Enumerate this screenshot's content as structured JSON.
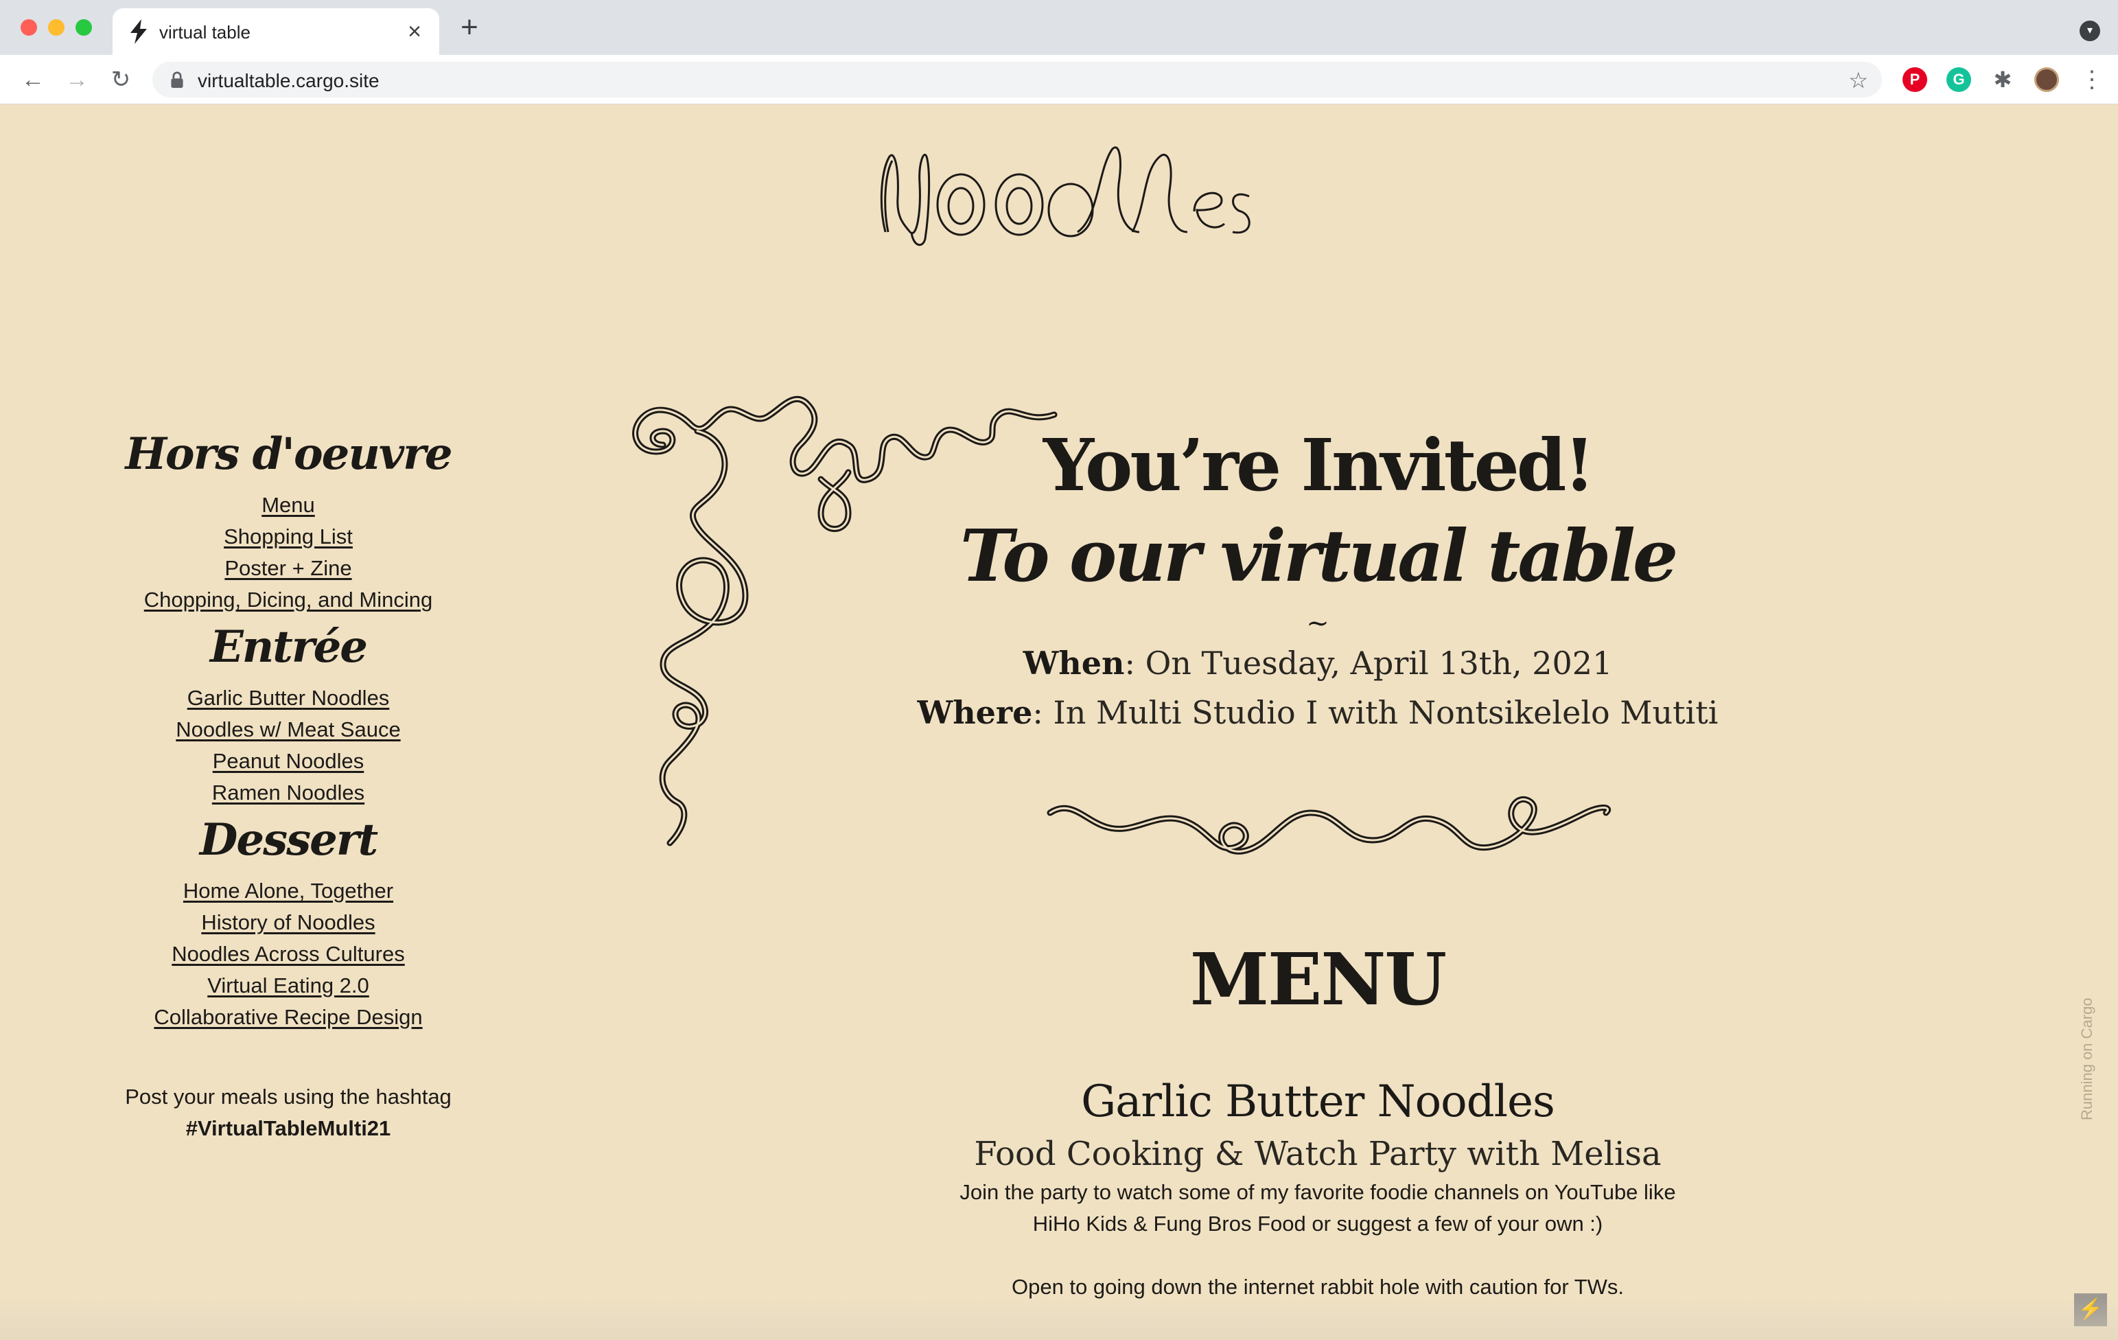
{
  "browser": {
    "tab_title": "virtual table",
    "tab_close": "×",
    "new_tab": "+",
    "url": "virtualtable.cargo.site",
    "nav_back": "←",
    "nav_forward": "→",
    "nav_reload": "↻",
    "bookmark_star": "☆",
    "ext_pinterest": "P",
    "ext_grammarly": "G",
    "ext_puzzle": "✱",
    "menu_kebab": "⋮",
    "tab_menu": "▾"
  },
  "site": {
    "logo_text": "Noodles",
    "sidebar": {
      "sections": [
        {
          "title": "Hors d'oeuvre",
          "links": [
            "Menu",
            "Shopping List",
            "Poster + Zine",
            "Chopping, Dicing, and Mincing"
          ]
        },
        {
          "title": "Entrée",
          "links": [
            "Garlic Butter Noodles",
            "Noodles w/ Meat Sauce",
            "Peanut Noodles",
            "Ramen Noodles"
          ]
        },
        {
          "title": "Dessert",
          "links": [
            "Home Alone, Together",
            "History of Noodles",
            "Noodles Across Cultures",
            "Virtual Eating 2.0",
            "Collaborative Recipe Design"
          ]
        }
      ],
      "hashtag_note": "Post your meals using the hashtag",
      "hashtag": "#VirtualTableMulti21"
    },
    "invite": {
      "line1": "You’re Invited!",
      "line2": "To our virtual table",
      "tilde": "~",
      "when_label": "When",
      "when_value": ": On Tuesday, April 13th, 2021",
      "where_label": "Where",
      "where_value": ": In Multi Studio I with Nontsikelelo Mutiti"
    },
    "menu": {
      "heading": "MENU",
      "dish_title": "Garlic Butter Noodles",
      "dish_subtitle": "Food Cooking & Watch Party with Melisa",
      "desc_line1": "Join the party to watch some of my favorite foodie channels on YouTube like",
      "desc_line2": "HiHo Kids & Fung Bros Food or suggest a few of your own :)",
      "desc_line3": "Open to going down the internet rabbit hole with caution for TWs."
    },
    "cargo_tag": "Running on Cargo",
    "cargo_button": "⚡"
  },
  "colors": {
    "page_bg": "#f0e1c3",
    "ink": "#1c1a17",
    "chrome_tabbar": "#dee1e6"
  }
}
